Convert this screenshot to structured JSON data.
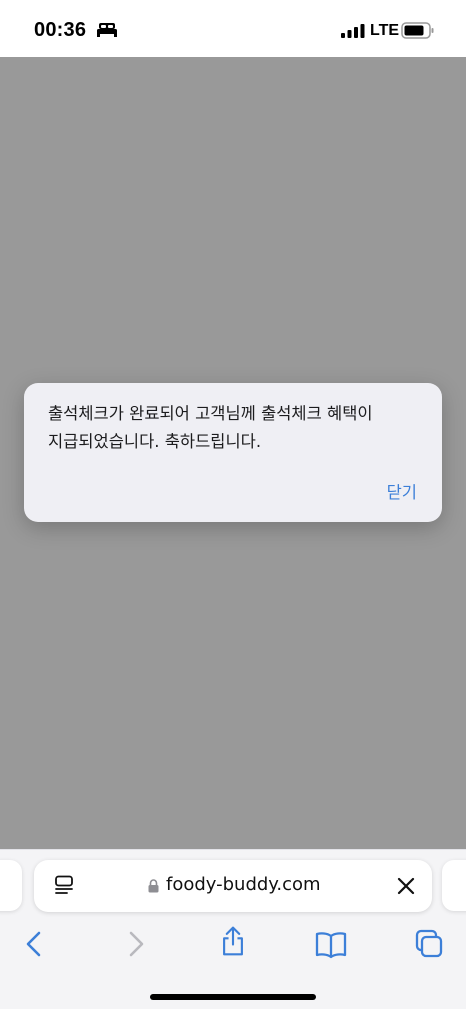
{
  "status_bar": {
    "time": "00:36",
    "network": "LTE",
    "icons": [
      "bed-icon",
      "cellular-signal-icon",
      "battery-icon"
    ]
  },
  "alert": {
    "message_line1": "출석체크가 완료되어 고객님께 출석체크 혜택이",
    "message_line2": "지급되었습니다. 축하드립니다.",
    "close_label": "닫기"
  },
  "browser": {
    "url": "foody-buddy.com",
    "icons": [
      "reader-icon",
      "lock-icon",
      "clear-icon",
      "back-icon",
      "forward-icon",
      "share-icon",
      "bookmarks-icon",
      "tabs-icon"
    ]
  },
  "colors": {
    "accent": "#3c7fd8",
    "dim_overlay": "#999999",
    "alert_background": "#efeff4",
    "toolbar_background": "#f4f4f6",
    "disabled_icon": "#b9b9be"
  }
}
